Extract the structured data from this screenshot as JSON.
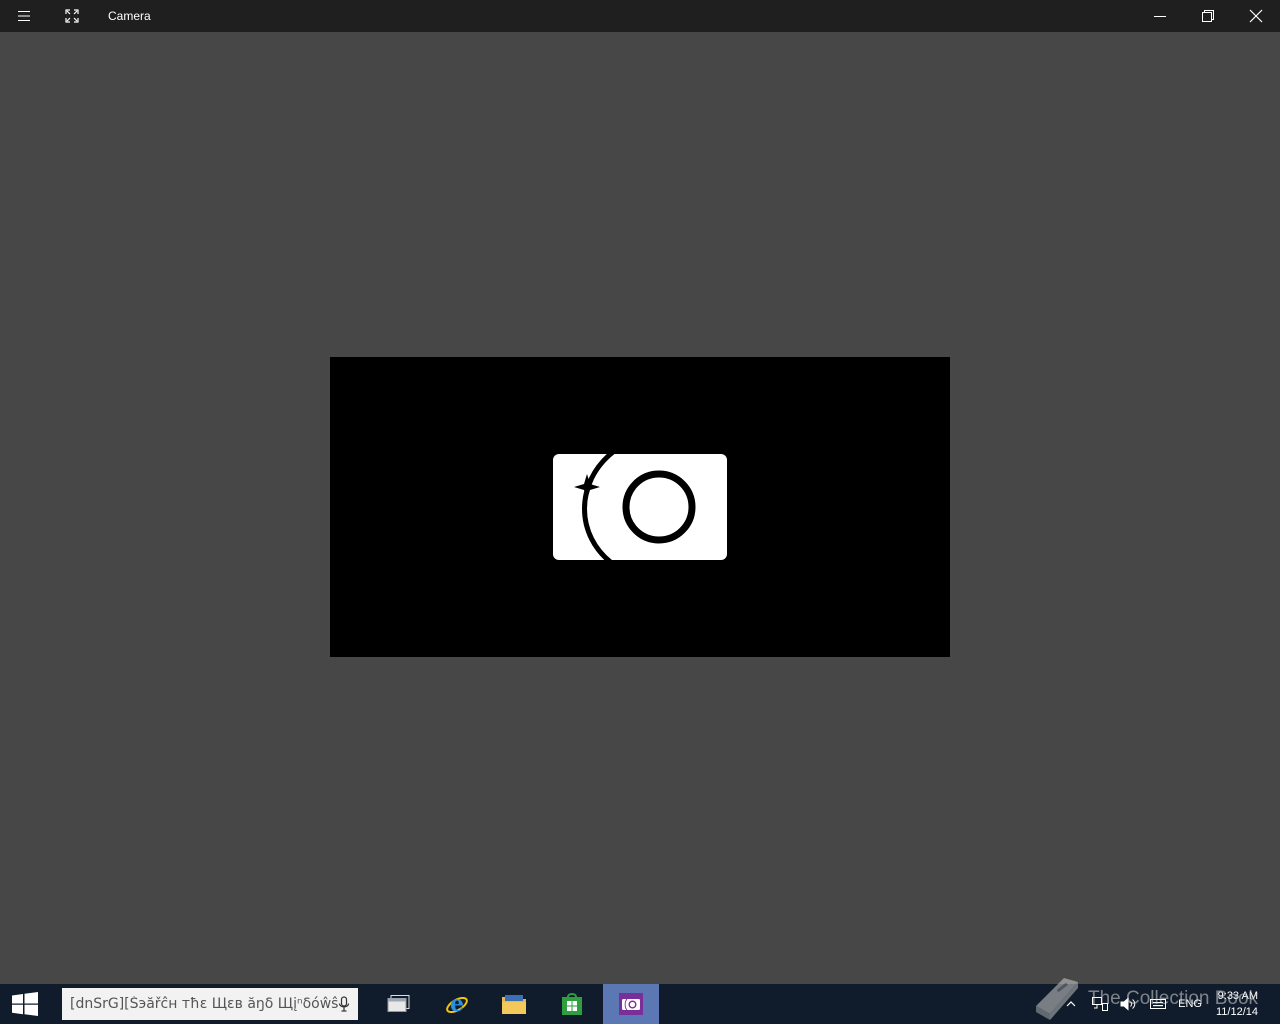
{
  "window": {
    "title": "Camera",
    "menu_icon": "hamburger-icon",
    "fullscreen_icon": "expand-icon",
    "controls": [
      "minimize-icon",
      "restore-icon",
      "close-icon"
    ]
  },
  "viewfinder": {
    "placeholder_icon": "camera-logo-icon"
  },
  "taskbar": {
    "search_placeholder": "[dnSrG][Šэăřĉн тħε Щεв ăŋδ Щįⁿδóŵŝ",
    "apps": [
      {
        "name": "task-view",
        "icon": "task-view-icon"
      },
      {
        "name": "internet-explorer",
        "icon": "ie-icon"
      },
      {
        "name": "file-explorer",
        "icon": "folder-icon"
      },
      {
        "name": "store",
        "icon": "store-icon"
      },
      {
        "name": "camera",
        "icon": "camera-icon",
        "active": true
      }
    ],
    "tray": {
      "language": "ENG",
      "time": "9:33 AM",
      "date": "11/12/14"
    }
  },
  "watermark": {
    "text": "The Collection Book"
  },
  "colors": {
    "titlebar": "#1f1f1f",
    "background": "#474747",
    "taskbar": "#101c2c",
    "active_app": "#5b78b5",
    "camera_app_tile": "#7a2e9a"
  }
}
